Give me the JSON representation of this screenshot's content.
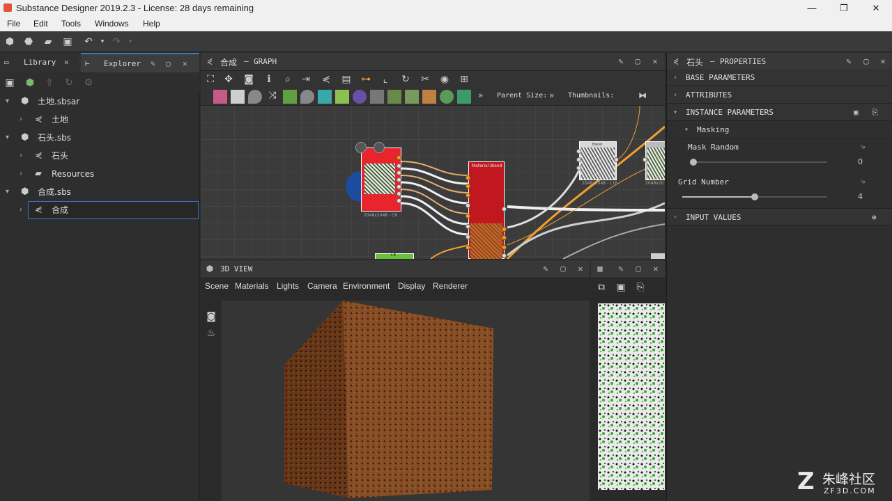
{
  "window": {
    "title": "Substance Designer 2019.2.3 - License: 28 days remaining",
    "minimize": "—",
    "restore": "❐",
    "close": "✕"
  },
  "menu": [
    "File",
    "Edit",
    "Tools",
    "Windows",
    "Help"
  ],
  "left_panel": {
    "tabs": [
      {
        "label": "Library"
      },
      {
        "label": "Explorer"
      }
    ],
    "tree": [
      {
        "label": "土地.sbsar",
        "level": 0,
        "expanded": true,
        "icon": "package-icon"
      },
      {
        "label": "土地",
        "level": 1,
        "expanded": false,
        "icon": "graph-icon"
      },
      {
        "label": "石头.sbs",
        "level": 0,
        "expanded": true,
        "icon": "package-icon"
      },
      {
        "label": "石头",
        "level": 1,
        "expanded": false,
        "icon": "graph-icon"
      },
      {
        "label": "Resources",
        "level": 1,
        "expanded": false,
        "icon": "folder-icon"
      },
      {
        "label": "合成.sbs",
        "level": 0,
        "expanded": true,
        "icon": "package-icon"
      },
      {
        "label": "合成",
        "level": 1,
        "expanded": false,
        "icon": "graph-icon",
        "selected": true
      }
    ]
  },
  "graph": {
    "title": "合成",
    "type": "GRAPH",
    "parent_size_label": "Parent Size:",
    "thumbnails_label": "Thumbnails:",
    "nodes": {
      "left_node_caption": "2048x2048 - C8",
      "blend_title": "Material Blend",
      "right_node_title": "Blend",
      "right_node_caption": "2048x2048 - L16",
      "far_node_caption": "2048x20",
      "green_node_label": "t.B"
    }
  },
  "view3d": {
    "title": "3D VIEW",
    "menu": [
      "Scene",
      "Materials",
      "Lights",
      "Camera",
      "Environment",
      "Display",
      "Renderer"
    ]
  },
  "properties": {
    "title": "石头",
    "type": "PROPERTIES",
    "sections": [
      {
        "label": "BASE PARAMETERS",
        "expanded": false
      },
      {
        "label": "ATTRIBUTES",
        "expanded": false
      },
      {
        "label": "INSTANCE PARAMETERS",
        "expanded": true
      }
    ],
    "group": "Masking",
    "params": [
      {
        "label": "Mask Random",
        "value": "0",
        "fraction": 0.0
      },
      {
        "label": "Grid Number",
        "value": "4",
        "fraction": 0.5
      }
    ],
    "input_values": "INPUT VALUES"
  },
  "watermark": {
    "brand": "朱峰社区",
    "site": "ZF3D.COM"
  }
}
